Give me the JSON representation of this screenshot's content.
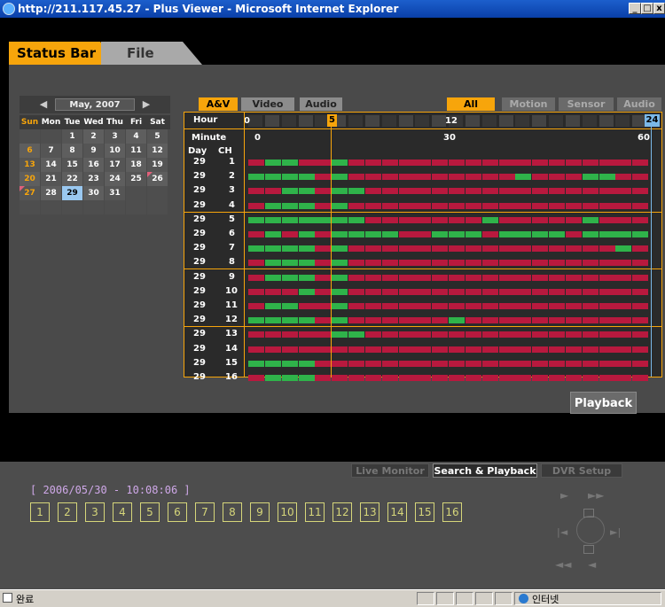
{
  "window": {
    "title": "http://211.117.45.27 - Plus Viewer - Microsoft Internet Explorer",
    "min": "_",
    "max": "□",
    "close": "x"
  },
  "tabs": {
    "status_bar": "Status Bar",
    "file_list": "File List"
  },
  "calendar": {
    "prev": "◀",
    "next": "▶",
    "month": "May, 2007",
    "weekdays": [
      "Sun",
      "Mon",
      "Tue",
      "Wed",
      "Thu",
      "Fri",
      "Sat"
    ],
    "weeks": [
      [
        "",
        "",
        "1",
        "2",
        "3",
        "4",
        "5"
      ],
      [
        "6",
        "7",
        "8",
        "9",
        "10",
        "11",
        "12"
      ],
      [
        "13",
        "14",
        "15",
        "16",
        "17",
        "18",
        "19"
      ],
      [
        "20",
        "21",
        "22",
        "23",
        "24",
        "25",
        "26"
      ],
      [
        "27",
        "28",
        "29",
        "30",
        "31",
        "",
        ""
      ],
      [
        "",
        "",
        "",
        "",
        "",
        "",
        ""
      ]
    ],
    "selected_day": "29",
    "colors": {
      "weekday_sun": "#f7a50b",
      "selected_bg": "#9ac8f0",
      "marker": "#e0607a"
    }
  },
  "timeline": {
    "filter_left": [
      "A&V",
      "Video",
      "Audio"
    ],
    "filter_right": [
      "All",
      "Motion",
      "Sensor",
      "Audio"
    ],
    "active_left": "A&V",
    "active_right": "All",
    "hour_label": "Hour",
    "minute_label": "Minute",
    "day_label": "Day",
    "ch_label": "CH",
    "hour_marks": [
      "0",
      "5",
      "12",
      "24"
    ],
    "minute_marks": [
      "0",
      "30",
      "60"
    ],
    "selected_hour": 5,
    "day": "29",
    "channels": [
      "1",
      "2",
      "3",
      "4",
      "5",
      "6",
      "7",
      "8",
      "9",
      "10",
      "11",
      "12",
      "13",
      "14",
      "15",
      "16"
    ],
    "record_segments": [
      [
        0,
        1,
        1,
        0,
        0,
        1,
        0,
        0,
        0,
        0,
        0,
        0,
        0,
        0,
        0,
        0,
        0,
        0,
        0,
        0,
        0,
        0,
        0,
        0
      ],
      [
        1,
        1,
        1,
        1,
        0,
        1,
        0,
        0,
        0,
        0,
        0,
        0,
        0,
        0,
        0,
        0,
        1,
        0,
        0,
        0,
        1,
        1,
        0,
        0
      ],
      [
        0,
        0,
        1,
        1,
        0,
        1,
        1,
        0,
        0,
        0,
        0,
        0,
        0,
        0,
        0,
        0,
        0,
        0,
        0,
        0,
        0,
        0,
        0,
        0
      ],
      [
        0,
        1,
        1,
        1,
        0,
        1,
        0,
        0,
        0,
        0,
        0,
        0,
        0,
        0,
        0,
        0,
        0,
        0,
        0,
        0,
        0,
        0,
        0,
        0
      ],
      [
        1,
        1,
        1,
        1,
        1,
        1,
        1,
        0,
        0,
        0,
        0,
        0,
        0,
        0,
        1,
        0,
        0,
        0,
        0,
        0,
        1,
        0,
        0,
        0
      ],
      [
        0,
        1,
        0,
        1,
        0,
        1,
        1,
        1,
        1,
        0,
        0,
        1,
        1,
        1,
        0,
        1,
        1,
        1,
        1,
        0,
        1,
        1,
        1,
        1
      ],
      [
        1,
        1,
        1,
        1,
        0,
        1,
        0,
        0,
        0,
        0,
        0,
        0,
        0,
        0,
        0,
        0,
        0,
        0,
        0,
        0,
        0,
        0,
        1,
        0
      ],
      [
        0,
        1,
        1,
        1,
        0,
        1,
        0,
        0,
        0,
        0,
        0,
        0,
        0,
        0,
        0,
        0,
        0,
        0,
        0,
        0,
        0,
        0,
        0,
        0
      ],
      [
        0,
        1,
        1,
        1,
        0,
        1,
        0,
        0,
        0,
        0,
        0,
        0,
        0,
        0,
        0,
        0,
        0,
        0,
        0,
        0,
        0,
        0,
        0,
        0
      ],
      [
        0,
        0,
        0,
        1,
        0,
        1,
        0,
        0,
        0,
        0,
        0,
        0,
        0,
        0,
        0,
        0,
        0,
        0,
        0,
        0,
        0,
        0,
        0,
        0
      ],
      [
        0,
        1,
        1,
        0,
        0,
        1,
        0,
        0,
        0,
        0,
        0,
        0,
        0,
        0,
        0,
        0,
        0,
        0,
        0,
        0,
        0,
        0,
        0,
        0
      ],
      [
        1,
        1,
        1,
        1,
        0,
        1,
        0,
        0,
        0,
        0,
        0,
        0,
        1,
        0,
        0,
        0,
        0,
        0,
        0,
        0,
        0,
        0,
        0,
        0
      ],
      [
        0,
        0,
        0,
        0,
        0,
        1,
        1,
        0,
        0,
        0,
        0,
        0,
        0,
        0,
        0,
        0,
        0,
        0,
        0,
        0,
        0,
        0,
        0,
        0
      ],
      [
        0,
        0,
        0,
        0,
        0,
        0,
        0,
        0,
        0,
        0,
        0,
        0,
        0,
        0,
        0,
        0,
        0,
        0,
        0,
        0,
        0,
        0,
        0,
        0
      ],
      [
        1,
        1,
        1,
        1,
        0,
        0,
        0,
        0,
        0,
        0,
        0,
        0,
        0,
        0,
        0,
        0,
        0,
        0,
        0,
        0,
        0,
        0,
        0,
        0
      ],
      [
        0,
        1,
        1,
        1,
        0,
        0,
        0,
        0,
        0,
        0,
        0,
        0,
        0,
        0,
        0,
        0,
        0,
        0,
        0,
        0,
        0,
        0,
        0,
        0
      ]
    ],
    "colors": {
      "record": "#2fb34a",
      "event": "#b8193e",
      "cursor": "#f7a50b",
      "end_marker": "#7ab8e8"
    }
  },
  "playback_label": "Playback",
  "bottom": {
    "tabs": [
      "Live Monitor",
      "Search & Playback",
      "DVR Setup"
    ],
    "active_tab": "Search & Playback",
    "datetime": "[ 2006/05/30 - 10:08:06 ]",
    "channel_buttons": [
      "1",
      "2",
      "3",
      "4",
      "5",
      "6",
      "7",
      "8",
      "9",
      "10",
      "11",
      "12",
      "13",
      "14",
      "15",
      "16"
    ],
    "controls": {
      "play": "►",
      "fast_forward": "►►",
      "prev": "|◄",
      "next": "►|",
      "rewind": "◄◄",
      "reverse": "◄"
    }
  },
  "statusbar": {
    "left_text": "완료",
    "zone_text": "인터넷"
  }
}
